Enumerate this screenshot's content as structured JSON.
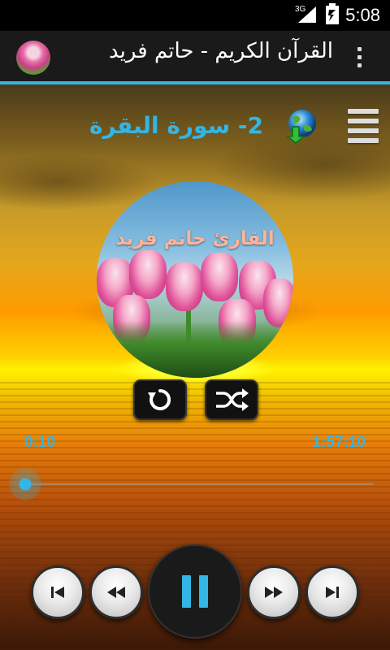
{
  "status_bar": {
    "time": "5:08",
    "network": "3G"
  },
  "app_bar": {
    "title": "القرآن الكريم - حاتم فريد"
  },
  "player": {
    "surah_title": "2- سورة البقرة",
    "reciter_label": "القارئ حاتم فريد",
    "elapsed": "0:10",
    "duration": "1:57:10",
    "progress_fraction": 0.0014
  },
  "colors": {
    "accent": "#33b5e5",
    "status_bar": "#000000",
    "action_bar": "#1a1a1a"
  },
  "icons": {
    "menu": "hamburger-menu-icon",
    "download": "globe-download-icon",
    "repeat": "repeat-icon",
    "shuffle": "shuffle-icon",
    "skip_previous": "skip-previous-icon",
    "rewind": "rewind-icon",
    "pause": "pause-icon",
    "fast_forward": "fast-forward-icon",
    "skip_next": "skip-next-icon",
    "overflow": "overflow-menu-icon"
  }
}
